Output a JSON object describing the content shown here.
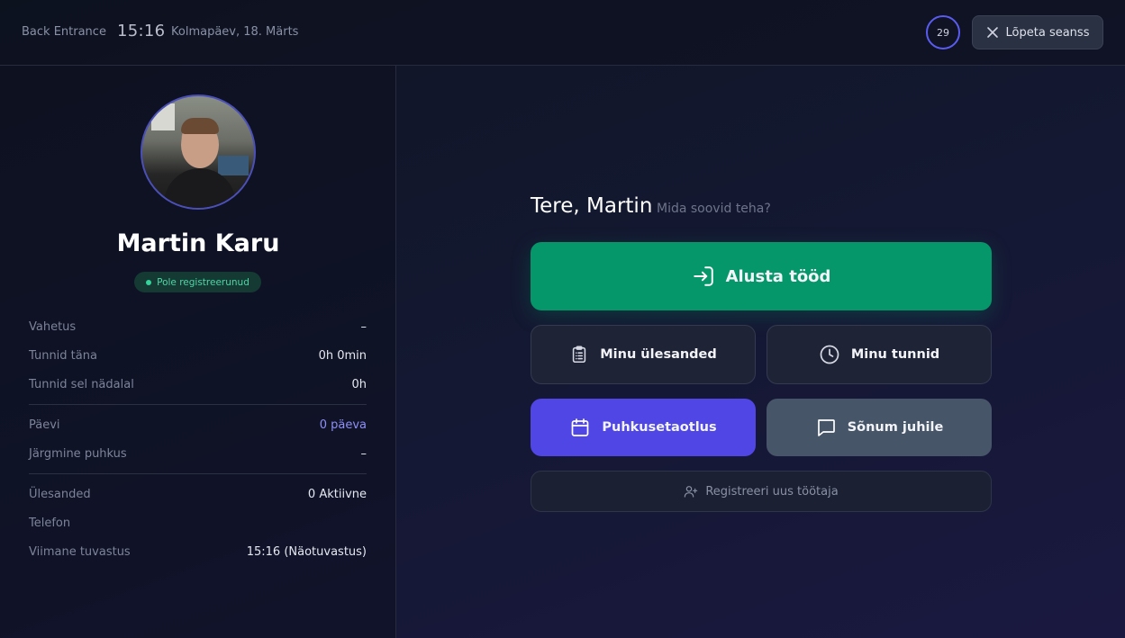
{
  "header": {
    "location": "Back Entrance",
    "time": "15:16",
    "date": "Kolmapäev, 18. Märts",
    "session_timer": "29",
    "end_session_label": "Lõpeta seanss"
  },
  "profile": {
    "name": "Martin Karu",
    "status_badge": "Pole registreerunud"
  },
  "info": {
    "group1": [
      {
        "label": "Vahetus",
        "value": "–"
      },
      {
        "label": "Tunnid täna",
        "value": "0h 0min"
      },
      {
        "label": "Tunnid sel nädalal",
        "value": "0h"
      }
    ],
    "group2": [
      {
        "label": "Päevi",
        "value": "0 päeva"
      },
      {
        "label": "Järgmine puhkus",
        "value": "–"
      }
    ],
    "group3": [
      {
        "label": "Ülesanded",
        "value": "0 Aktiivne"
      },
      {
        "label": "Telefon",
        "value": ""
      },
      {
        "label": "Viimane tuvastus",
        "value": "15:16 (Näotuvastus)"
      }
    ]
  },
  "main": {
    "greeting": "Tere, Martin",
    "subtitle": "Mida soovid teha?",
    "start_work_label": "Alusta tööd",
    "my_tasks_label": "Minu ülesanded",
    "my_hours_label": "Minu tunnid",
    "vacation_label": "Puhkusetaotlus",
    "message_label": "Sõnum juhile",
    "register_label": "Registreeri uus töötaja"
  },
  "colors": {
    "start_green": "#059669",
    "vacation_indigo": "#4f46e5",
    "message_slate": "#475569",
    "accent_text": "#8d8ff6",
    "badge_green": "#34d399"
  }
}
